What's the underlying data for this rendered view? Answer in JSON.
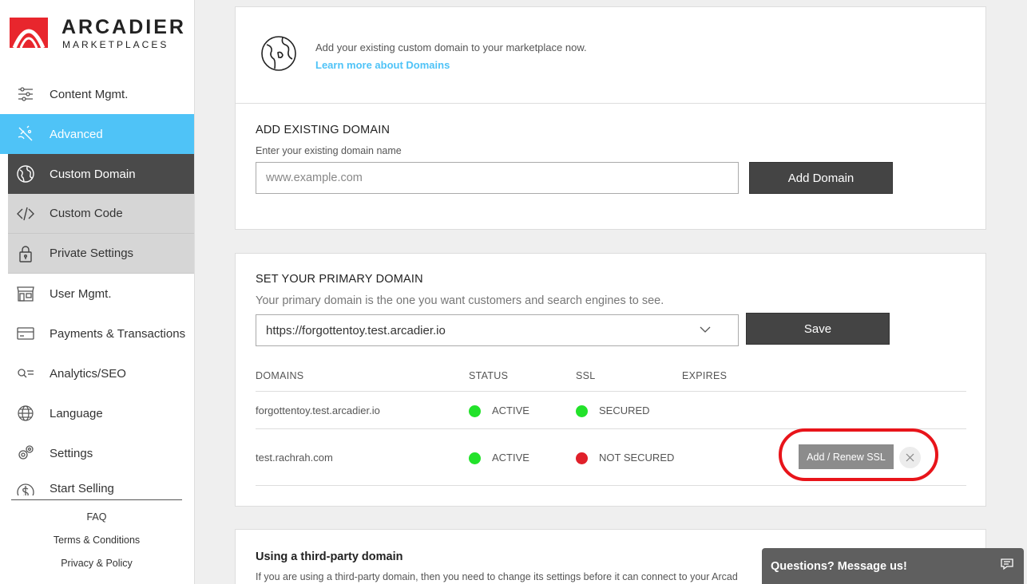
{
  "brand": {
    "title": "ARCADIER",
    "subtitle": "MARKETPLACES",
    "mark_color": "#e8262d"
  },
  "sidebar": {
    "items": [
      {
        "label": "Content Mgmt.",
        "icon": "sliders-icon"
      },
      {
        "label": "Advanced",
        "icon": "wand-icon"
      },
      {
        "label": "Custom Domain",
        "icon": "globe-icon"
      },
      {
        "label": "Custom Code",
        "icon": "code-icon"
      },
      {
        "label": "Private Settings",
        "icon": "lock-icon"
      },
      {
        "label": "User Mgmt.",
        "icon": "store-icon"
      },
      {
        "label": "Payments & Transactions",
        "icon": "card-icon"
      },
      {
        "label": "Analytics/SEO",
        "icon": "search-list-icon"
      },
      {
        "label": "Language",
        "icon": "language-icon"
      },
      {
        "label": "Settings",
        "icon": "gears-icon"
      },
      {
        "label": "Start Selling",
        "icon": "dollar-icon"
      }
    ],
    "footer": {
      "faq": "FAQ",
      "terms": "Terms & Conditions",
      "privacy": "Privacy & Policy"
    }
  },
  "domain_intro": {
    "text": "Add your existing custom domain to your marketplace now.",
    "link": "Learn more about Domains"
  },
  "add_domain": {
    "title": "ADD EXISTING DOMAIN",
    "label": "Enter your existing domain name",
    "placeholder": "www.example.com",
    "button": "Add Domain"
  },
  "primary_domain": {
    "title": "SET YOUR PRIMARY DOMAIN",
    "description": "Your primary domain is the one you want customers and search engines to see.",
    "selected": "https://forgottentoy.test.arcadier.io",
    "save": "Save",
    "columns": {
      "domains": "DOMAINS",
      "status": "STATUS",
      "ssl": "SSL",
      "expires": "EXPIRES"
    },
    "rows": [
      {
        "domain": "forgottentoy.test.arcadier.io",
        "status": "ACTIVE",
        "status_color": "#22e22a",
        "ssl": "SECURED",
        "ssl_color": "#22e22a"
      },
      {
        "domain": "test.rachrah.com",
        "status": "ACTIVE",
        "status_color": "#22e22a",
        "ssl": "NOT SECURED",
        "ssl_color": "#e0202a",
        "action": "Add / Renew SSL"
      }
    ]
  },
  "third_party": {
    "title": "Using a third-party domain",
    "text": "If you are using a third-party domain, then you need to change its settings before it can connect to your Arcad"
  },
  "chat": {
    "label": "Questions? Message us!"
  }
}
